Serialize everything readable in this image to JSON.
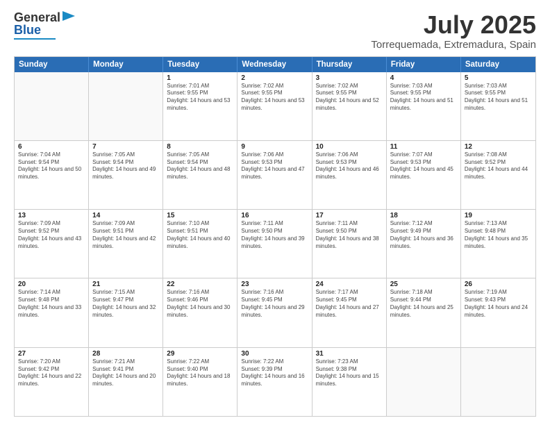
{
  "logo": {
    "line1": "General",
    "line2": "Blue"
  },
  "title": "July 2025",
  "subtitle": "Torrequemada, Extremadura, Spain",
  "header_days": [
    "Sunday",
    "Monday",
    "Tuesday",
    "Wednesday",
    "Thursday",
    "Friday",
    "Saturday"
  ],
  "weeks": [
    [
      {
        "day": "",
        "sunrise": "",
        "sunset": "",
        "daylight": "",
        "empty": true
      },
      {
        "day": "",
        "sunrise": "",
        "sunset": "",
        "daylight": "",
        "empty": true
      },
      {
        "day": "1",
        "sunrise": "Sunrise: 7:01 AM",
        "sunset": "Sunset: 9:55 PM",
        "daylight": "Daylight: 14 hours and 53 minutes.",
        "empty": false
      },
      {
        "day": "2",
        "sunrise": "Sunrise: 7:02 AM",
        "sunset": "Sunset: 9:55 PM",
        "daylight": "Daylight: 14 hours and 53 minutes.",
        "empty": false
      },
      {
        "day": "3",
        "sunrise": "Sunrise: 7:02 AM",
        "sunset": "Sunset: 9:55 PM",
        "daylight": "Daylight: 14 hours and 52 minutes.",
        "empty": false
      },
      {
        "day": "4",
        "sunrise": "Sunrise: 7:03 AM",
        "sunset": "Sunset: 9:55 PM",
        "daylight": "Daylight: 14 hours and 51 minutes.",
        "empty": false
      },
      {
        "day": "5",
        "sunrise": "Sunrise: 7:03 AM",
        "sunset": "Sunset: 9:55 PM",
        "daylight": "Daylight: 14 hours and 51 minutes.",
        "empty": false
      }
    ],
    [
      {
        "day": "6",
        "sunrise": "Sunrise: 7:04 AM",
        "sunset": "Sunset: 9:54 PM",
        "daylight": "Daylight: 14 hours and 50 minutes.",
        "empty": false
      },
      {
        "day": "7",
        "sunrise": "Sunrise: 7:05 AM",
        "sunset": "Sunset: 9:54 PM",
        "daylight": "Daylight: 14 hours and 49 minutes.",
        "empty": false
      },
      {
        "day": "8",
        "sunrise": "Sunrise: 7:05 AM",
        "sunset": "Sunset: 9:54 PM",
        "daylight": "Daylight: 14 hours and 48 minutes.",
        "empty": false
      },
      {
        "day": "9",
        "sunrise": "Sunrise: 7:06 AM",
        "sunset": "Sunset: 9:53 PM",
        "daylight": "Daylight: 14 hours and 47 minutes.",
        "empty": false
      },
      {
        "day": "10",
        "sunrise": "Sunrise: 7:06 AM",
        "sunset": "Sunset: 9:53 PM",
        "daylight": "Daylight: 14 hours and 46 minutes.",
        "empty": false
      },
      {
        "day": "11",
        "sunrise": "Sunrise: 7:07 AM",
        "sunset": "Sunset: 9:53 PM",
        "daylight": "Daylight: 14 hours and 45 minutes.",
        "empty": false
      },
      {
        "day": "12",
        "sunrise": "Sunrise: 7:08 AM",
        "sunset": "Sunset: 9:52 PM",
        "daylight": "Daylight: 14 hours and 44 minutes.",
        "empty": false
      }
    ],
    [
      {
        "day": "13",
        "sunrise": "Sunrise: 7:09 AM",
        "sunset": "Sunset: 9:52 PM",
        "daylight": "Daylight: 14 hours and 43 minutes.",
        "empty": false
      },
      {
        "day": "14",
        "sunrise": "Sunrise: 7:09 AM",
        "sunset": "Sunset: 9:51 PM",
        "daylight": "Daylight: 14 hours and 42 minutes.",
        "empty": false
      },
      {
        "day": "15",
        "sunrise": "Sunrise: 7:10 AM",
        "sunset": "Sunset: 9:51 PM",
        "daylight": "Daylight: 14 hours and 40 minutes.",
        "empty": false
      },
      {
        "day": "16",
        "sunrise": "Sunrise: 7:11 AM",
        "sunset": "Sunset: 9:50 PM",
        "daylight": "Daylight: 14 hours and 39 minutes.",
        "empty": false
      },
      {
        "day": "17",
        "sunrise": "Sunrise: 7:11 AM",
        "sunset": "Sunset: 9:50 PM",
        "daylight": "Daylight: 14 hours and 38 minutes.",
        "empty": false
      },
      {
        "day": "18",
        "sunrise": "Sunrise: 7:12 AM",
        "sunset": "Sunset: 9:49 PM",
        "daylight": "Daylight: 14 hours and 36 minutes.",
        "empty": false
      },
      {
        "day": "19",
        "sunrise": "Sunrise: 7:13 AM",
        "sunset": "Sunset: 9:48 PM",
        "daylight": "Daylight: 14 hours and 35 minutes.",
        "empty": false
      }
    ],
    [
      {
        "day": "20",
        "sunrise": "Sunrise: 7:14 AM",
        "sunset": "Sunset: 9:48 PM",
        "daylight": "Daylight: 14 hours and 33 minutes.",
        "empty": false
      },
      {
        "day": "21",
        "sunrise": "Sunrise: 7:15 AM",
        "sunset": "Sunset: 9:47 PM",
        "daylight": "Daylight: 14 hours and 32 minutes.",
        "empty": false
      },
      {
        "day": "22",
        "sunrise": "Sunrise: 7:16 AM",
        "sunset": "Sunset: 9:46 PM",
        "daylight": "Daylight: 14 hours and 30 minutes.",
        "empty": false
      },
      {
        "day": "23",
        "sunrise": "Sunrise: 7:16 AM",
        "sunset": "Sunset: 9:45 PM",
        "daylight": "Daylight: 14 hours and 29 minutes.",
        "empty": false
      },
      {
        "day": "24",
        "sunrise": "Sunrise: 7:17 AM",
        "sunset": "Sunset: 9:45 PM",
        "daylight": "Daylight: 14 hours and 27 minutes.",
        "empty": false
      },
      {
        "day": "25",
        "sunrise": "Sunrise: 7:18 AM",
        "sunset": "Sunset: 9:44 PM",
        "daylight": "Daylight: 14 hours and 25 minutes.",
        "empty": false
      },
      {
        "day": "26",
        "sunrise": "Sunrise: 7:19 AM",
        "sunset": "Sunset: 9:43 PM",
        "daylight": "Daylight: 14 hours and 24 minutes.",
        "empty": false
      }
    ],
    [
      {
        "day": "27",
        "sunrise": "Sunrise: 7:20 AM",
        "sunset": "Sunset: 9:42 PM",
        "daylight": "Daylight: 14 hours and 22 minutes.",
        "empty": false
      },
      {
        "day": "28",
        "sunrise": "Sunrise: 7:21 AM",
        "sunset": "Sunset: 9:41 PM",
        "daylight": "Daylight: 14 hours and 20 minutes.",
        "empty": false
      },
      {
        "day": "29",
        "sunrise": "Sunrise: 7:22 AM",
        "sunset": "Sunset: 9:40 PM",
        "daylight": "Daylight: 14 hours and 18 minutes.",
        "empty": false
      },
      {
        "day": "30",
        "sunrise": "Sunrise: 7:22 AM",
        "sunset": "Sunset: 9:39 PM",
        "daylight": "Daylight: 14 hours and 16 minutes.",
        "empty": false
      },
      {
        "day": "31",
        "sunrise": "Sunrise: 7:23 AM",
        "sunset": "Sunset: 9:38 PM",
        "daylight": "Daylight: 14 hours and 15 minutes.",
        "empty": false
      },
      {
        "day": "",
        "sunrise": "",
        "sunset": "",
        "daylight": "",
        "empty": true
      },
      {
        "day": "",
        "sunrise": "",
        "sunset": "",
        "daylight": "",
        "empty": true
      }
    ]
  ]
}
